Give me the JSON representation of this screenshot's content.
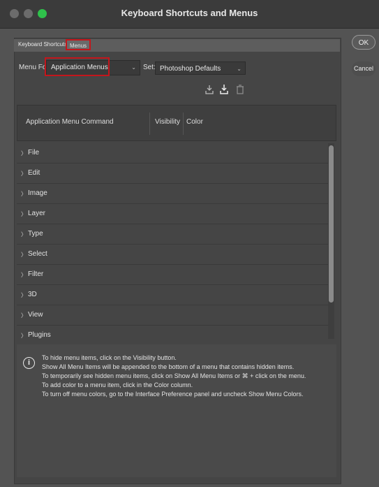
{
  "window": {
    "title": "Keyboard Shortcuts and Menus"
  },
  "tabs": [
    {
      "label": "Keyboard Shortcuts"
    },
    {
      "label": "Menus"
    }
  ],
  "controls": {
    "menu_for_label": "Menu For:",
    "menu_for_value": "Application Menus",
    "set_label": "Set:",
    "set_value": "Photoshop Defaults"
  },
  "buttons": {
    "ok": "OK",
    "cancel": "Cancel"
  },
  "table": {
    "headers": {
      "command": "Application Menu Command",
      "visibility": "Visibility",
      "color": "Color"
    },
    "rows": [
      "File",
      "Edit",
      "Image",
      "Layer",
      "Type",
      "Select",
      "Filter",
      "3D",
      "View",
      "Plugins"
    ]
  },
  "info": {
    "lines": [
      "To hide menu items, click on the Visibility button.",
      "Show All Menu Items will be appended to the bottom of a menu that contains hidden items.",
      "To temporarily see hidden menu items, click on Show All Menu Items or ⌘ + click on the menu.",
      "To add color to a menu item, click in the Color column.",
      "To turn off menu colors, go to the Interface Preference panel and uncheck Show Menu Colors."
    ]
  },
  "icons": {
    "save": "save-icon",
    "save_as": "save-as-icon",
    "delete": "trash-icon",
    "info": "info-icon",
    "expand": "chevron-right-icon"
  },
  "colors": {
    "highlight": "#c4161c",
    "panel": "#454545"
  }
}
